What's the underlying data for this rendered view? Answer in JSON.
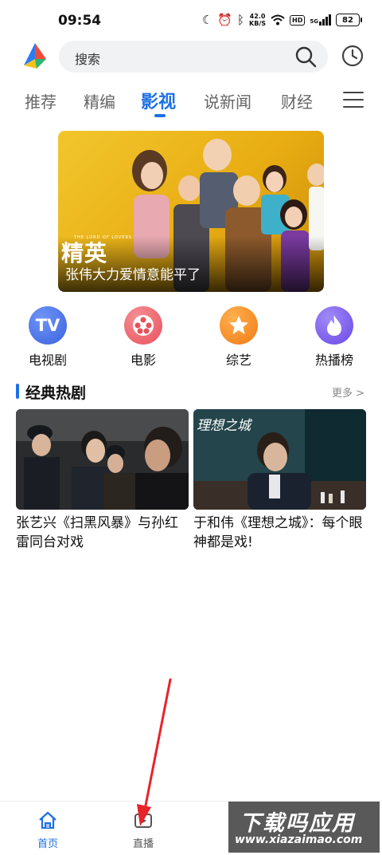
{
  "status_bar": {
    "time": "09:54",
    "net_speed": "42.0",
    "net_unit": "KB/S",
    "hd": "HD",
    "signal": "5G",
    "battery": "82"
  },
  "header": {
    "search_placeholder": "搜索"
  },
  "tabs": [
    "推荐",
    "精编",
    "影视",
    "说新闻",
    "财经"
  ],
  "active_tab": "影视",
  "banner": {
    "title": "张伟大力爱情意能平了",
    "logo_text": "精英",
    "logo_sub": "THE LORD OF LOVERS"
  },
  "categories": [
    {
      "label": "电视剧",
      "icon": "tv-icon",
      "color": "#4a73e8"
    },
    {
      "label": "电影",
      "icon": "film-reel-icon",
      "color": "#ef6b73"
    },
    {
      "label": "综艺",
      "icon": "star-icon",
      "color": "#f28a22"
    },
    {
      "label": "热播榜",
      "icon": "flame-icon",
      "color": "#7a5af0"
    }
  ],
  "category_tv_text": "TV",
  "section": {
    "title": "经典热剧",
    "more": "更多 >"
  },
  "cards": [
    {
      "title": "张艺兴《扫黑风暴》与孙红雷同台对戏"
    },
    {
      "title": "于和伟《理想之城》：每个眼神都是戏!",
      "thumb_text": "理想之城"
    }
  ],
  "bottom_nav": [
    {
      "label": "首页",
      "icon": "home-icon",
      "active": true
    },
    {
      "label": "直播",
      "icon": "live-play-icon",
      "active": false
    }
  ],
  "watermark": {
    "main": "下载吗应用",
    "url": "www.xiazaimao.com"
  },
  "colors": {
    "accent": "#1e6fe6",
    "annotation": "#e8232a"
  }
}
